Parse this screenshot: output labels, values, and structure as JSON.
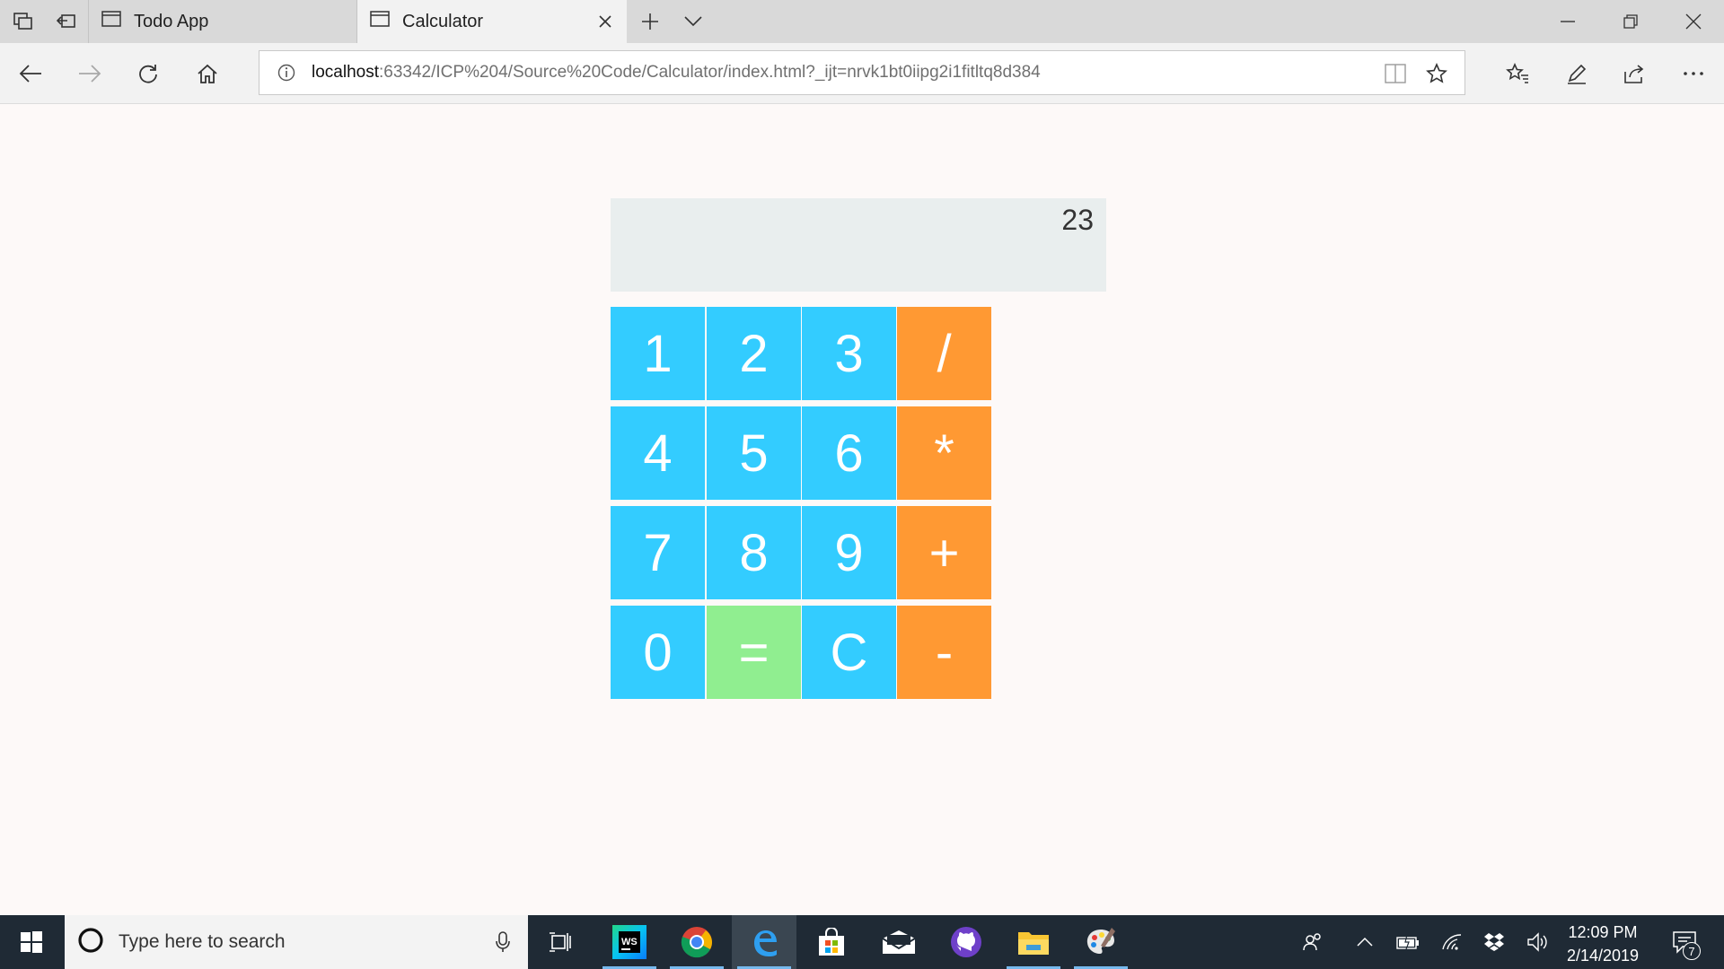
{
  "browser": {
    "tabs": [
      {
        "title": "Todo App",
        "active": false
      },
      {
        "title": "Calculator",
        "active": true
      }
    ],
    "url": {
      "host": "localhost",
      "path": ":63342/ICP%204/Source%20Code/Calculator/index.html?_ijt=nrvk1bt0iipg2i1fitltq8d384"
    }
  },
  "calculator": {
    "display": "23",
    "keys": {
      "k1": "1",
      "k2": "2",
      "k3": "3",
      "div": "/",
      "k4": "4",
      "k5": "5",
      "k6": "6",
      "mul": "*",
      "k7": "7",
      "k8": "8",
      "k9": "9",
      "add": "+",
      "k0": "0",
      "eq": "=",
      "clear": "C",
      "sub": "-"
    },
    "colors": {
      "number": "#33ccff",
      "operator": "#ff9933",
      "equals": "#90ee90",
      "display_bg": "#e9eeee"
    }
  },
  "taskbar": {
    "search_placeholder": "Type here to search",
    "time": "12:09 PM",
    "date": "2/14/2019",
    "notification_count": "7",
    "apps": [
      "task-view-icon",
      "webstorm-icon",
      "chrome-icon",
      "edge-icon",
      "store-icon",
      "mail-icon",
      "github-icon",
      "file-explorer-icon",
      "paint-icon"
    ]
  }
}
